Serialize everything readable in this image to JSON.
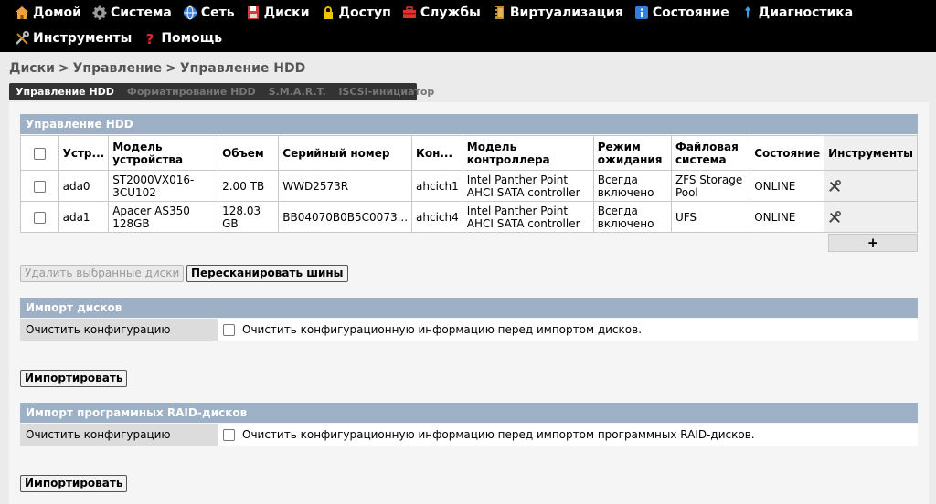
{
  "nav": {
    "row1": [
      {
        "label": "Домой",
        "icon": "home-icon"
      },
      {
        "label": "Система",
        "icon": "gear-icon"
      },
      {
        "label": "Сеть",
        "icon": "globe-icon"
      },
      {
        "label": "Диски",
        "icon": "floppy-icon"
      },
      {
        "label": "Доступ",
        "icon": "lock-icon"
      },
      {
        "label": "Службы",
        "icon": "toolbox-icon"
      },
      {
        "label": "Виртуализация",
        "icon": "film-icon"
      },
      {
        "label": "Состояние",
        "icon": "info-icon"
      },
      {
        "label": "Диагностика",
        "icon": "pin-icon"
      }
    ],
    "row2": [
      {
        "label": "Инструменты",
        "icon": "tools-icon"
      },
      {
        "label": "Помощь",
        "icon": "question-icon"
      }
    ]
  },
  "breadcrumb": [
    "Диски",
    "Управление",
    "Управление HDD"
  ],
  "breadcrumb_sep": ">",
  "tabs": [
    {
      "label": "Управление HDD",
      "active": true
    },
    {
      "label": "Форматирование HDD",
      "active": false
    },
    {
      "label": "S.M.A.R.T.",
      "active": false
    },
    {
      "label": "iSCSI-инициатор",
      "active": false
    }
  ],
  "hdd_section": {
    "title": "Управление HDD",
    "columns": [
      "",
      "Устр...",
      "Модель устройства",
      "Объем",
      "Серийный номер",
      "Кон...",
      "Модель контроллера",
      "Режим ожидания",
      "Файловая система",
      "Состояние",
      "Инструменты"
    ],
    "rows": [
      {
        "device": "ada0",
        "model": "ST2000VX016-3CU102",
        "size": "2.00 TB",
        "serial": "WWD2573R",
        "controller": "ahcich1",
        "controller_model": "Intel Panther Point AHCI SATA controller",
        "standby": "Всегда включено",
        "fs": "ZFS Storage Pool",
        "status": "ONLINE"
      },
      {
        "device": "ada1",
        "model": "Apacer AS350 128GB",
        "size": "128.03 GB",
        "serial": "BB04070B0B5C0073...",
        "controller": "ahcich4",
        "controller_model": "Intel Panther Point AHCI SATA controller",
        "standby": "Всегда включено",
        "fs": "UFS",
        "status": "ONLINE"
      }
    ],
    "add_label": "+",
    "delete_label": "Удалить выбранные диски",
    "rescan_label": "Пересканировать шины"
  },
  "import_section": {
    "title": "Импорт дисков",
    "row_label": "Очистить конфигурацию",
    "row_text": "Очистить конфигурационную информацию перед импортом дисков.",
    "button": "Импортировать"
  },
  "raid_section": {
    "title": "Импорт программных RAID-дисков",
    "row_label": "Очистить конфигурацию",
    "row_text": "Очистить конфигурационную информацию перед импортом программных RAID-дисков.",
    "button": "Импортировать"
  }
}
